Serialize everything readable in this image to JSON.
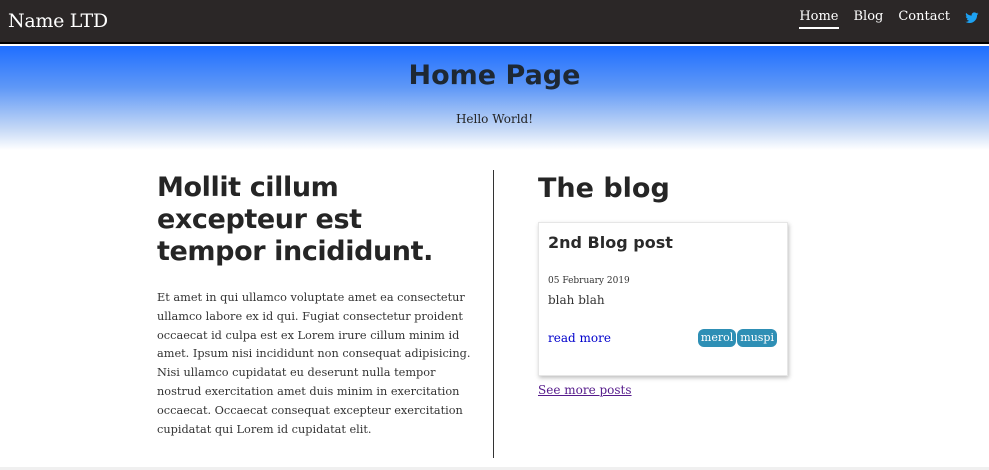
{
  "navbar": {
    "brand": "Name LTD",
    "links": [
      {
        "label": "Home",
        "active": true
      },
      {
        "label": "Blog",
        "active": false
      },
      {
        "label": "Contact",
        "active": false
      }
    ],
    "social_icon": "twitter-icon",
    "social_icon_color": "#1da1f2"
  },
  "hero": {
    "title": "Home Page",
    "subtitle": "Hello World!",
    "gradient_top": "#1f6eff",
    "gradient_bottom": "#ffffff"
  },
  "article": {
    "title": "Mollit cillum excepteur est tempor incididunt.",
    "body": "Et amet in qui ullamco voluptate amet ea consectetur ullamco labore ex id qui. Fugiat consectetur proident occaecat id culpa est ex Lorem irure cillum minim id amet. Ipsum nisi incididunt non consequat adipisicing. Nisi ullamco cupidatat eu deserunt nulla tempor nostrud exercitation amet duis minim in exercitation occaecat. Occaecat consequat excepteur exercitation cupidatat qui Lorem id cupidatat elit."
  },
  "blog": {
    "heading": "The blog",
    "post": {
      "title": "2nd Blog post",
      "date": "05 February 2019",
      "excerpt": "blah blah",
      "read_more": "read more",
      "tags": [
        "merol",
        "muspi"
      ],
      "tag_color": "#2e8fb5"
    },
    "more_posts": "See more posts"
  }
}
